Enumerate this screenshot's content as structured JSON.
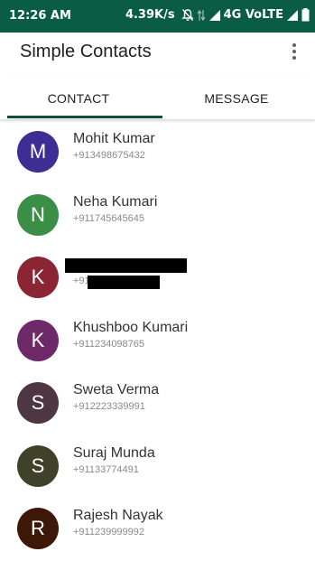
{
  "status_bar": {
    "time": "12:26 AM",
    "network_speed": "4.39K/s",
    "network_type": "4G VoLTE",
    "icons": [
      "bell-off-icon",
      "data-arrows-icon",
      "signal-icon",
      "battery-icon"
    ],
    "background": "#0a5c45"
  },
  "app_bar": {
    "title": "Simple Contacts",
    "menu_icon": "more-vert-icon"
  },
  "tabs": [
    {
      "label": "CONTACT",
      "selected": true
    },
    {
      "label": "MESSAGE",
      "selected": false
    }
  ],
  "accent_color": "#0e4f3f",
  "contacts": [
    {
      "initial": "M",
      "name": "Mohit Kumar",
      "phone": "+913498675432",
      "color": "#3f2d96",
      "redacted": false
    },
    {
      "initial": "N",
      "name": "Neha Kumari",
      "phone": "+911745645645",
      "color": "#3a8e46",
      "redacted": false
    },
    {
      "initial": "K",
      "name": "",
      "phone": "+91",
      "color": "#8b2533",
      "redacted": true
    },
    {
      "initial": "K",
      "name": "Khushboo Kumari",
      "phone": "+911234098765",
      "color": "#6e2a68",
      "redacted": false
    },
    {
      "initial": "S",
      "name": "Sweta Verma",
      "phone": "+912223339991",
      "color": "#4e3742",
      "redacted": false
    },
    {
      "initial": "S",
      "name": "Suraj Munda",
      "phone": "+91133774491",
      "color": "#3f4129",
      "redacted": false
    },
    {
      "initial": "R",
      "name": "Rajesh Nayak",
      "phone": "+911239999992",
      "color": "#3d1808",
      "redacted": false
    }
  ]
}
